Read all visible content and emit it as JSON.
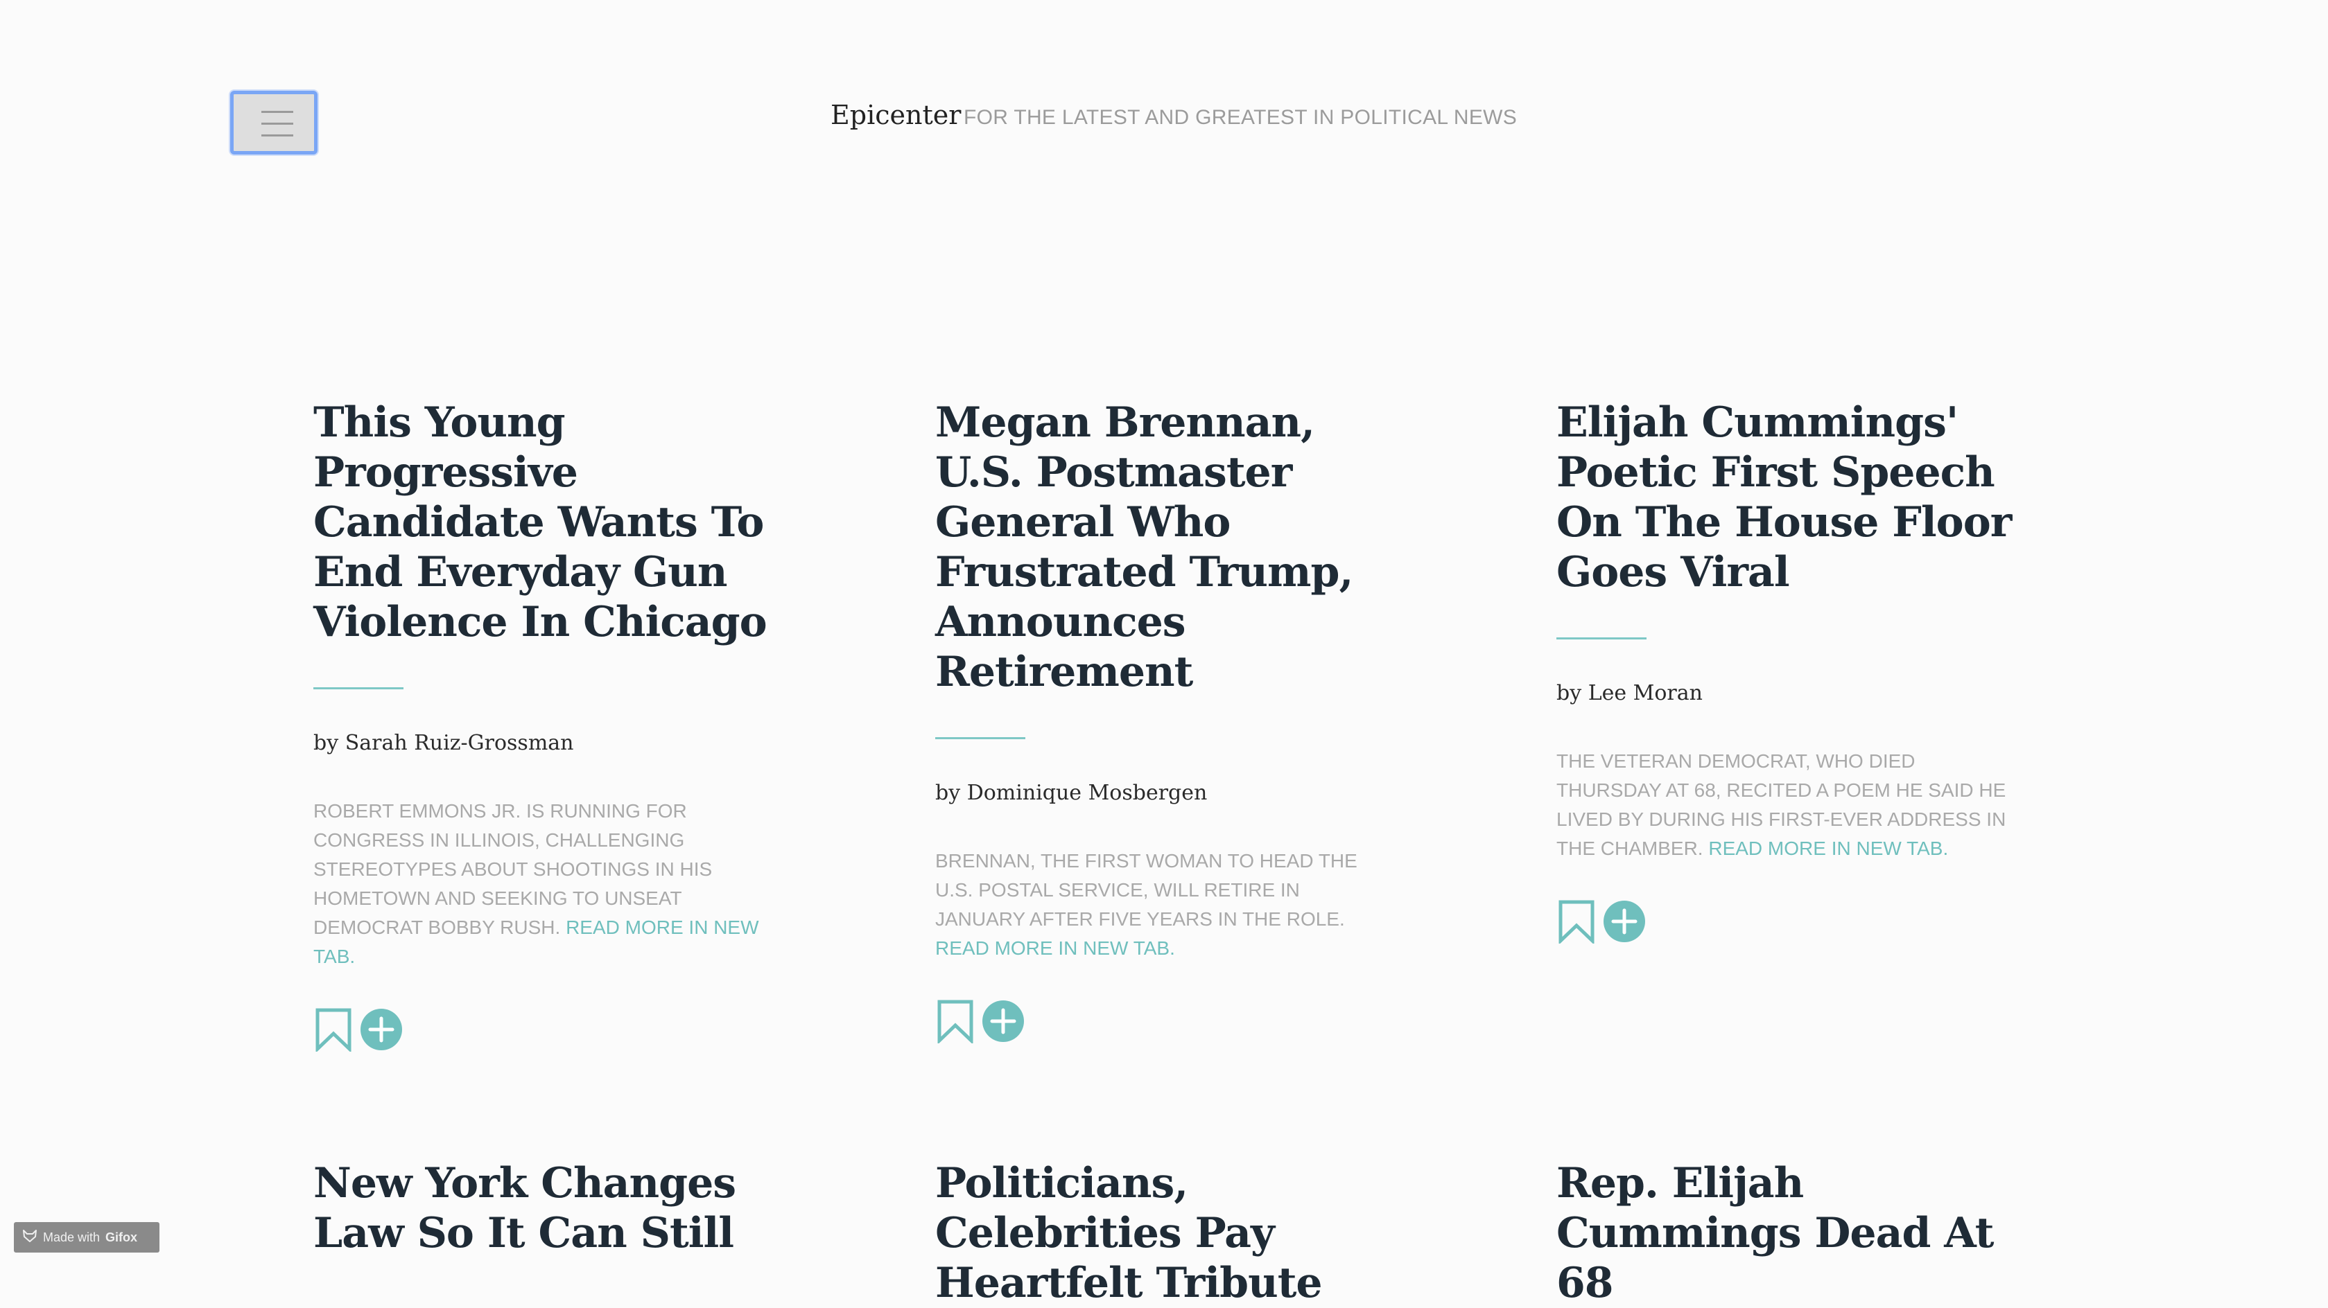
{
  "header": {
    "brand": "Epicenter",
    "tagline": "FOR THE LATEST AND GREATEST IN POLITICAL NEWS",
    "menu_icon": "hamburger-icon"
  },
  "articles": [
    {
      "title": "This Young Progressive Candidate Wants To End Everyday Gun Violence In Chicago",
      "byline": "by Sarah Ruiz-Grossman",
      "summary": "ROBERT EMMONS JR. IS RUNNING FOR CONGRESS IN ILLINOIS, CHALLENGING STEREOTYPES ABOUT SHOOTINGS IN HIS HOMETOWN AND SEEKING TO UNSEAT DEMOCRAT BOBBY RUSH.",
      "read_more": "READ MORE IN NEW TAB."
    },
    {
      "title": "Megan Brennan, U.S. Postmaster General Who Frustrated Trump, Announces Retirement",
      "byline": "by Dominique Mosbergen",
      "summary": "BRENNAN, THE FIRST WOMAN TO HEAD THE U.S. POSTAL SERVICE, WILL RETIRE IN JANUARY AFTER FIVE YEARS IN THE ROLE.",
      "read_more": "READ MORE IN NEW TAB."
    },
    {
      "title": "Elijah Cummings' Poetic First Speech On The House Floor Goes Viral",
      "byline": "by Lee Moran",
      "summary": "THE VETERAN DEMOCRAT, WHO DIED THURSDAY AT 68, RECITED A POEM HE SAID HE LIVED BY DURING HIS FIRST-EVER ADDRESS IN THE CHAMBER.",
      "read_more": "READ MORE IN NEW TAB."
    },
    {
      "title": "New York Changes Law So It Can Still"
    },
    {
      "title": "Politicians, Celebrities Pay Heartfelt Tribute"
    },
    {
      "title": "Rep. Elijah Cummings Dead At 68"
    }
  ],
  "icons": {
    "bookmark": "bookmark-icon",
    "add": "plus-circle-icon"
  },
  "colors": {
    "accent": "#6fbfbd",
    "title": "#1f2b36",
    "muted": "#a9a9a9",
    "menu_focus": "#7aa6f5"
  },
  "watermark": {
    "prefix": "Made with",
    "brand": "Gifox"
  }
}
